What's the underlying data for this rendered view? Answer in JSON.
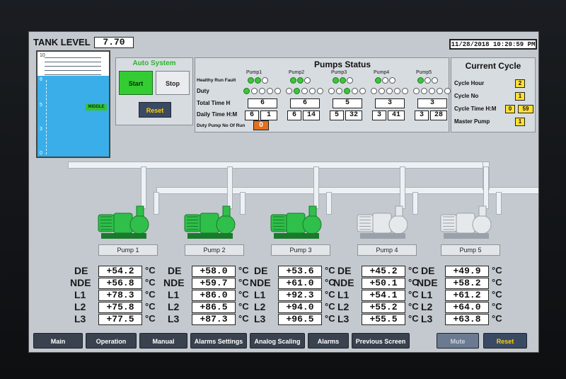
{
  "tank": {
    "title": "TANK LEVEL",
    "value": "7.70",
    "scale": [
      "10",
      "8",
      "5",
      "3",
      "0"
    ],
    "level_fraction": 0.77,
    "indicator": "MIDDLE"
  },
  "datetime": "11/28/2018 10:20:59 PM",
  "auto_system": {
    "title": "Auto System",
    "start": "Start",
    "stop": "Stop",
    "reset": "Reset"
  },
  "pumps_status": {
    "title": "Pumps Status",
    "pump_names": [
      "Pump1",
      "Pump2",
      "Pump3",
      "Pump4",
      "Pump5"
    ],
    "row_hrf": "Healthy Run Fault",
    "row_duty": "Duty",
    "row_total": "Total Time H",
    "row_daily": "Daily Time H:M",
    "row_duty_no": "Duty Pump No Of Run",
    "duty_no_value": "0",
    "pumps": [
      {
        "healthy": true,
        "run": true,
        "fault": false,
        "duty": [
          true,
          false,
          false,
          false,
          false
        ],
        "total": "6",
        "daily_h": "6",
        "daily_m": "1"
      },
      {
        "healthy": true,
        "run": true,
        "fault": false,
        "duty": [
          false,
          true,
          false,
          false,
          false
        ],
        "total": "6",
        "daily_h": "6",
        "daily_m": "14"
      },
      {
        "healthy": true,
        "run": true,
        "fault": false,
        "duty": [
          false,
          false,
          true,
          false,
          false
        ],
        "total": "5",
        "daily_h": "5",
        "daily_m": "32"
      },
      {
        "healthy": true,
        "run": false,
        "fault": false,
        "duty": [
          false,
          false,
          false,
          false,
          false
        ],
        "total": "3",
        "daily_h": "3",
        "daily_m": "41"
      },
      {
        "healthy": true,
        "run": false,
        "fault": false,
        "duty": [
          false,
          false,
          false,
          false,
          false
        ],
        "total": "3",
        "daily_h": "3",
        "daily_m": "28"
      }
    ]
  },
  "current_cycle": {
    "title": "Current Cycle",
    "hour_label": "Cycle Hour",
    "hour_value": "2",
    "no_label": "Cycle No",
    "no_value": "1",
    "time_label": "Cycle Time H:M",
    "time_h": "0",
    "time_m": "59",
    "master_label": "Master Pump",
    "master_value": "1"
  },
  "temp_labels": [
    "DE",
    "NDE",
    "L1",
    "L2",
    "L3"
  ],
  "unit": "°C",
  "pumps": [
    {
      "label": "Pump 1",
      "running": true,
      "temps": [
        "+54.2",
        "+56.8",
        "+78.3",
        "+75.8",
        "+77.5"
      ]
    },
    {
      "label": "Pump 2",
      "running": true,
      "temps": [
        "+58.0",
        "+59.7",
        "+86.0",
        "+86.5",
        "+87.3"
      ]
    },
    {
      "label": "Pump 3",
      "running": true,
      "temps": [
        "+53.6",
        "+61.0",
        "+92.3",
        "+94.0",
        "+96.5"
      ]
    },
    {
      "label": "Pump 4",
      "running": false,
      "temps": [
        "+45.2",
        "+50.1",
        "+54.1",
        "+55.2",
        "+55.5"
      ]
    },
    {
      "label": "Pump 5",
      "running": false,
      "temps": [
        "+49.9",
        "+58.2",
        "+61.2",
        "+64.0",
        "+63.8"
      ]
    }
  ],
  "nav": [
    "Main",
    "Operation",
    "Manual",
    "Alarms Settings",
    "Analog Scaling",
    "Alarms",
    "Previous Screen",
    "Mute",
    "Reset"
  ],
  "colors": {
    "start_green": "#33cc33",
    "reset_blue": "#3b4a63",
    "mute_bg": "#6b7a90",
    "reset_text": "#ffd200",
    "duty_orange": "#e2701e"
  }
}
